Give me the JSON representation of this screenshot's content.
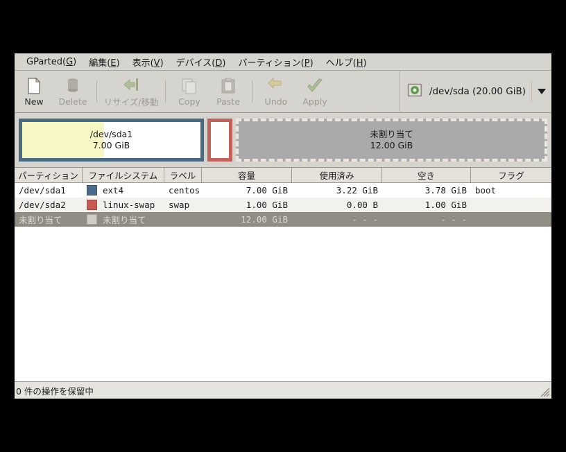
{
  "window": {
    "title": "GParted"
  },
  "menubar": {
    "items": [
      {
        "label": "GParted(G)",
        "text_before": "GParted(",
        "mnemonic": "G",
        "text_after": ")"
      },
      {
        "label": "編集(E)",
        "text_before": "編集(",
        "mnemonic": "E",
        "text_after": ")"
      },
      {
        "label": "表示(V)",
        "text_before": "表示(",
        "mnemonic": "V",
        "text_after": ")"
      },
      {
        "label": "デバイス(D)",
        "text_before": "デバイス(",
        "mnemonic": "D",
        "text_after": ")"
      },
      {
        "label": "パーティション(P)",
        "text_before": "パーティション(",
        "mnemonic": "P",
        "text_after": ")"
      },
      {
        "label": "ヘルプ(H)",
        "text_before": "ヘルプ(",
        "mnemonic": "H",
        "text_after": ")"
      }
    ]
  },
  "toolbar": {
    "buttons": [
      {
        "label": "New",
        "icon": "new-document-icon",
        "enabled": true
      },
      {
        "label": "Delete",
        "icon": "trash-can-icon",
        "enabled": false
      },
      {
        "label": "リサイズ/移動",
        "icon": "resize-move-icon",
        "enabled": false
      },
      {
        "label": "Copy",
        "icon": "copy-icon",
        "enabled": false
      },
      {
        "label": "Paste",
        "icon": "paste-clipboard-icon",
        "enabled": false
      },
      {
        "label": "Undo",
        "icon": "undo-arrow-icon",
        "enabled": false
      },
      {
        "label": "Apply",
        "icon": "apply-checkmark-icon",
        "enabled": false
      }
    ],
    "device_selector": {
      "icon": "hard-disk-icon",
      "value": "/dev/sda  (20.00 GiB)",
      "caret": "chevron-down-icon"
    }
  },
  "diskview": {
    "partitions": [
      {
        "name": "/dev/sda1",
        "size": "7.00 GiB",
        "border_color": "#4a6a84",
        "used_fill_color": "#f7f7c4",
        "used_percent": 46
      },
      {
        "name": "/dev/sda2",
        "size": "1.00 GiB",
        "border_color": "#c2625a",
        "label_visible": false
      },
      {
        "name": "未割り当て",
        "size": "12.00 GiB",
        "fill_color": "#aaaaaa",
        "border_color": "#e9e7e0"
      }
    ]
  },
  "table": {
    "headers": [
      "パーティション",
      "ファイルシステム",
      "ラベル",
      "容量",
      "使用済み",
      "空き",
      "フラグ"
    ],
    "rows": [
      {
        "partition": "/dev/sda1",
        "filesystem": "ext4",
        "swatch_color": "#4a6a8c",
        "label": "centos",
        "size": "7.00 GiB",
        "used": "3.22 GiB",
        "free": "3.78 GiB",
        "flags": "boot"
      },
      {
        "partition": "/dev/sda2",
        "filesystem": "linux-swap",
        "swatch_color": "#c85a52",
        "label": "swap",
        "size": "1.00 GiB",
        "used": "0.00 B",
        "free": "1.00 GiB",
        "flags": ""
      },
      {
        "partition": "未割り当て",
        "filesystem": "未割り当て",
        "swatch_color": "#cfcdc6",
        "label": "",
        "size": "12.00 GiB",
        "used": "- - -",
        "free": "- - -",
        "flags": ""
      }
    ]
  },
  "statusbar": {
    "text": "0 件の操作を保留中",
    "grip": "resize-grip-icon"
  }
}
